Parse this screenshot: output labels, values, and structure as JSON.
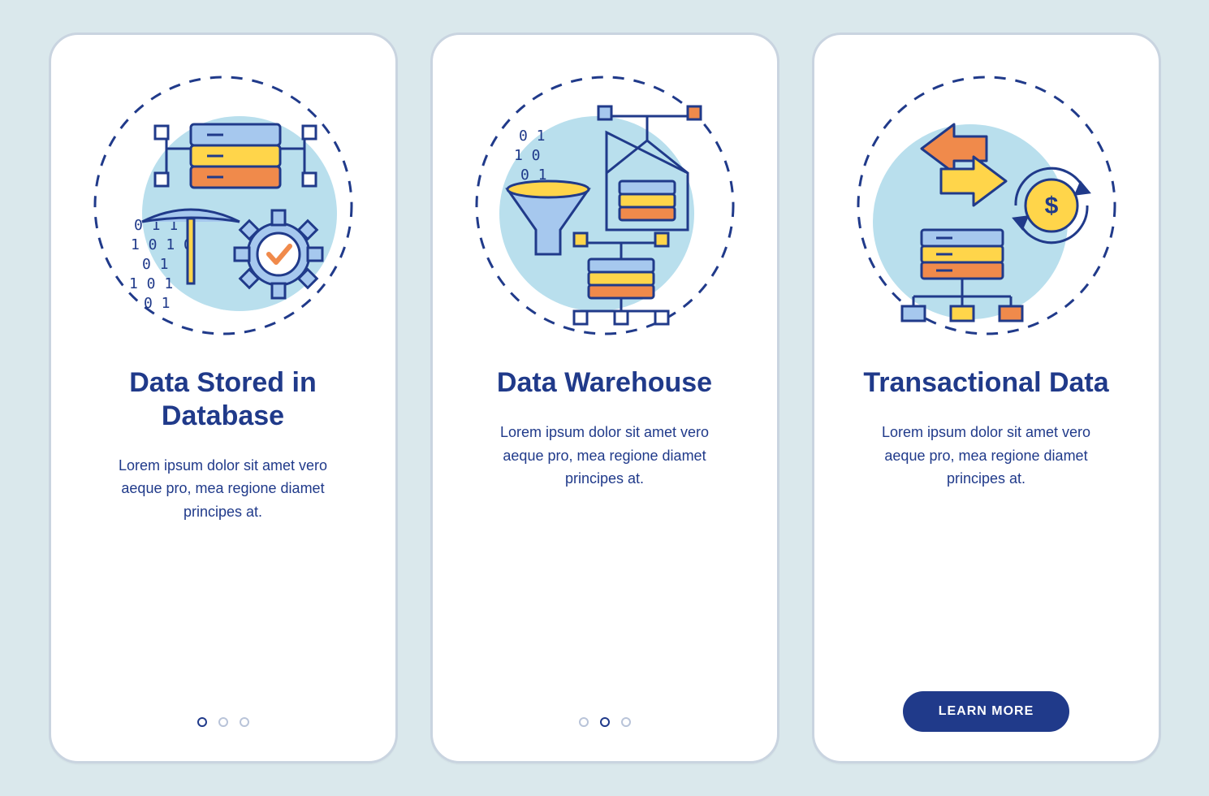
{
  "colors": {
    "navy": "#203a8a",
    "blueFill": "#a6c8ee",
    "yellow": "#ffd54a",
    "orange": "#f08a4b",
    "lightBg": "#b9dfed"
  },
  "screens": [
    {
      "title": "Data Stored in Database",
      "description": "Lorem ipsum dolor sit amet vero aeque pro, mea regione diamet principes at.",
      "activeDot": 0,
      "cta": null
    },
    {
      "title": "Data Warehouse",
      "description": "Lorem ipsum dolor sit amet vero aeque pro, mea regione diamet principes at.",
      "activeDot": 1,
      "cta": null
    },
    {
      "title": "Transactional Data",
      "description": "Lorem ipsum dolor sit amet vero aeque pro, mea regione diamet principes at.",
      "activeDot": null,
      "cta": "LEARN MORE"
    }
  ]
}
